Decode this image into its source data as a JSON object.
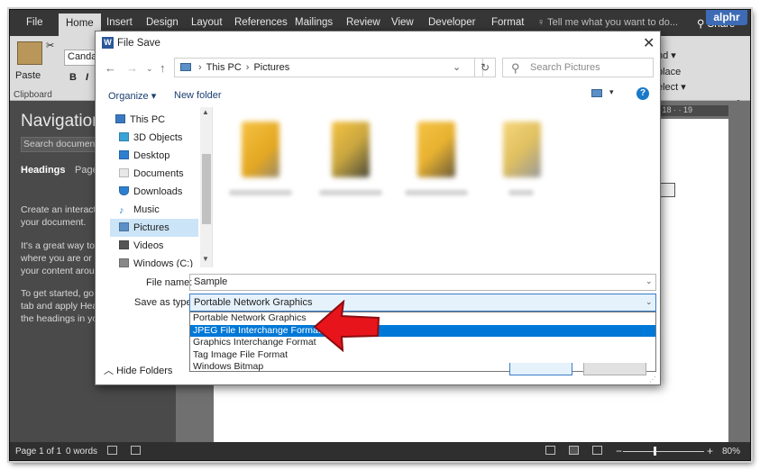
{
  "word": {
    "tabs": [
      "File",
      "Home",
      "Insert",
      "Design",
      "Layout",
      "References",
      "Mailings",
      "Review",
      "View",
      "Developer",
      "Format"
    ],
    "active_tab": "Home",
    "tell_me": "Tell me what you want to do...",
    "share": "Share",
    "watermark": "alphr",
    "paste_label": "Paste",
    "font_name": "Candar",
    "bold": "B",
    "italic": "I",
    "clipboard_label": "Clipboard",
    "ribbon_right": {
      "find": "nd ▾",
      "replace": "place",
      "select": "elect ▾",
      "editing": "ting"
    },
    "ruler_numbers": "· 18 · · 19",
    "nav": {
      "title": "Navigation",
      "search_placeholder": "Search document",
      "tab_headings": "Headings",
      "tab_pages": "Page",
      "lines": [
        "Create an interactiv",
        "your document.",
        "It's a great way to k",
        "where you are or q",
        "your content aroun",
        "To get started, go t",
        "tab and apply Hea",
        "the headings in you"
      ]
    },
    "status": {
      "page": "Page 1 of 1",
      "words": "0 words",
      "zoom": "80%"
    }
  },
  "dialog": {
    "title": "File Save",
    "address": [
      "This PC",
      "Pictures"
    ],
    "search_placeholder": "Search Pictures",
    "organize": "Organize ▾",
    "new_folder": "New folder",
    "tree": [
      {
        "label": "This PC",
        "icon": "computer-icon",
        "color": "#3b78c2"
      },
      {
        "label": "3D Objects",
        "icon": "cube-icon",
        "color": "#3aa3d6"
      },
      {
        "label": "Desktop",
        "icon": "desktop-icon",
        "color": "#2f7fd0"
      },
      {
        "label": "Documents",
        "icon": "document-icon",
        "color": "#e8e8e8"
      },
      {
        "label": "Downloads",
        "icon": "download-icon",
        "color": "#2f7fd0"
      },
      {
        "label": "Music",
        "icon": "music-icon",
        "color": "#2f7fd0"
      },
      {
        "label": "Pictures",
        "icon": "pictures-icon",
        "color": "#5c8fc7"
      },
      {
        "label": "Videos",
        "icon": "video-icon",
        "color": "#555555"
      },
      {
        "label": "Windows (C:)",
        "icon": "drive-icon",
        "color": "#888888"
      }
    ],
    "selected_tree_item": "Pictures",
    "file_name_label": "File name:",
    "file_name": "Sample",
    "save_as_type_label": "Save as type:",
    "save_as_type": "Portable Network Graphics",
    "type_options": [
      "Portable Network Graphics",
      "JPEG File Interchange Format",
      "Graphics Interchange Format",
      "Tag Image File Format",
      "Windows Bitmap"
    ],
    "highlighted_option": "JPEG File Interchange Format",
    "hide_folders": "Hide Folders",
    "arrow_color": "#e8141b"
  }
}
